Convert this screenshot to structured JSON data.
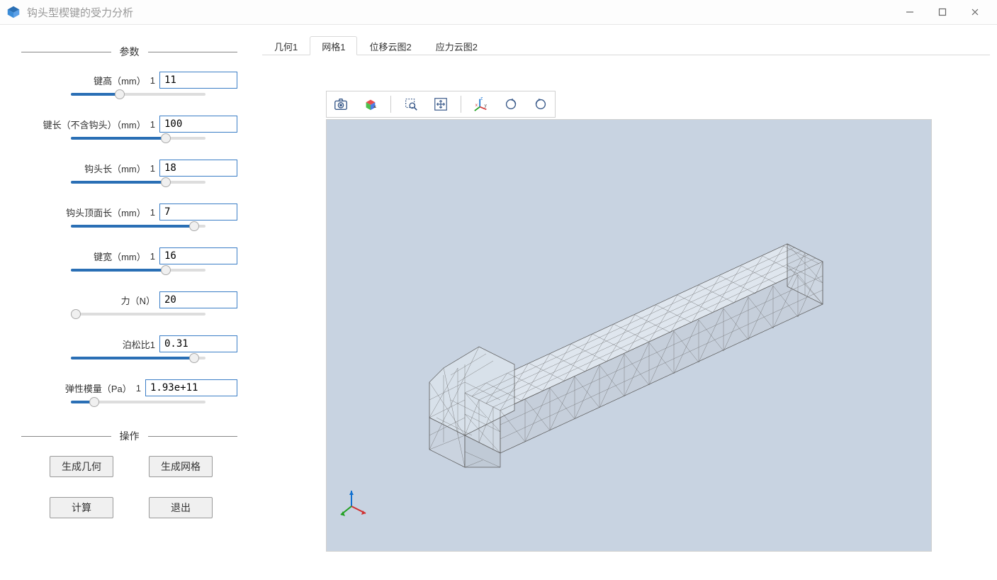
{
  "app": {
    "title": "钩头型楔键的受力分析"
  },
  "sections": {
    "params": "参数",
    "actions": "操作"
  },
  "params": [
    {
      "label": "键高（mm）",
      "index": "1",
      "value": "11",
      "slider_pct": 35
    },
    {
      "label": "键长（不含钩头）（mm）",
      "index": "1",
      "value": "100",
      "slider_pct": 72
    },
    {
      "label": "钩头长（mm）",
      "index": "1",
      "value": "18",
      "slider_pct": 72
    },
    {
      "label": "钩头顶面长（mm）",
      "index": "1",
      "value": "7",
      "slider_pct": 95
    },
    {
      "label": "键宽（mm）",
      "index": "1",
      "value": "16",
      "slider_pct": 72
    },
    {
      "label": "力（N）",
      "index": "",
      "value": "20",
      "slider_pct": 0
    },
    {
      "label": "泊松比1",
      "index": "",
      "value": "0.31",
      "slider_pct": 95
    },
    {
      "label": "弹性模量（Pa）",
      "index": "1",
      "value": "1.93e+11",
      "slider_pct": 15
    }
  ],
  "buttons": {
    "gen_geom": "生成几何",
    "gen_mesh": "生成网格",
    "compute": "计算",
    "exit": "退出"
  },
  "tabs": [
    {
      "label": "几何1",
      "active": false
    },
    {
      "label": "网格1",
      "active": true
    },
    {
      "label": "位移云图2",
      "active": false
    },
    {
      "label": "应力云图2",
      "active": false
    }
  ],
  "toolbar_icons": [
    "camera-icon",
    "view-cube-icon",
    "separator",
    "zoom-select-icon",
    "pan-expand-icon",
    "separator",
    "axes-icon",
    "rotate-cw-icon",
    "rotate-ccw-icon"
  ]
}
